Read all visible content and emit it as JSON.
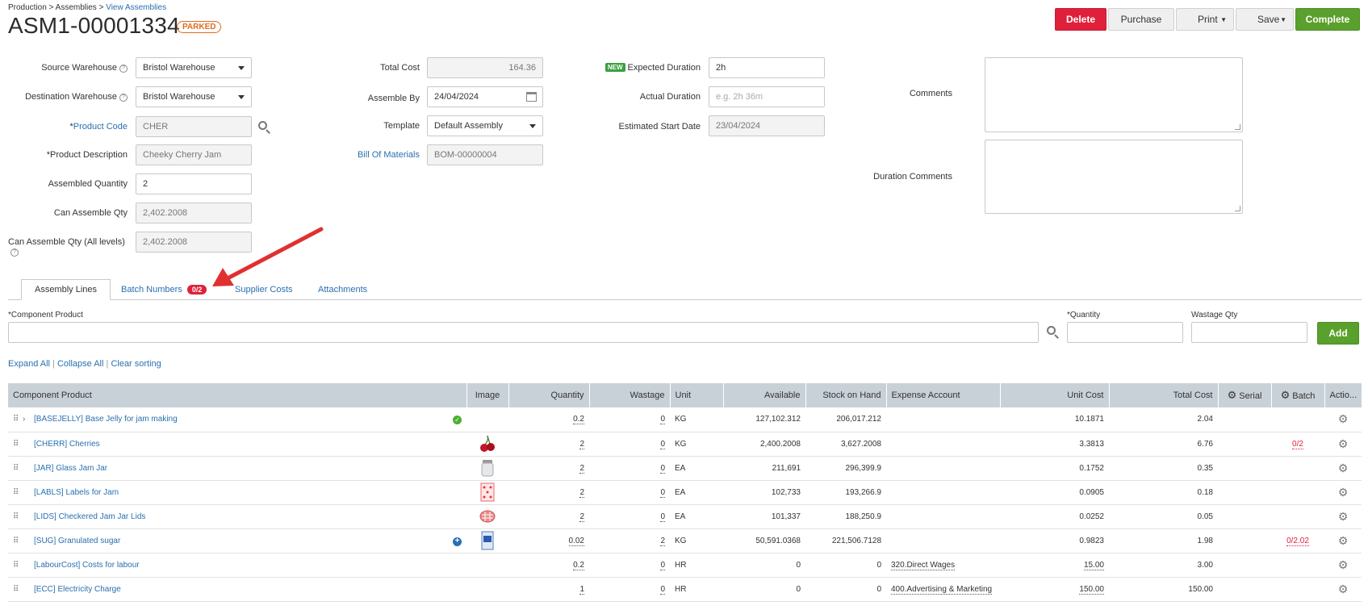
{
  "breadcrumb": {
    "part1": "Production",
    "sep1": " > ",
    "part2": "Assemblies",
    "sep2": " > ",
    "part3": "View Assemblies"
  },
  "header": {
    "title": "ASM1-00001334",
    "status": "PARKED"
  },
  "actions": {
    "delete": "Delete",
    "purchase": "Purchase",
    "print": "Print",
    "save": "Save",
    "complete": "Complete"
  },
  "form": {
    "source_warehouse_label": "Source Warehouse",
    "source_warehouse": "Bristol Warehouse",
    "destination_warehouse_label": "Destination Warehouse",
    "destination_warehouse": "Bristol Warehouse",
    "product_code_label": "Product Code",
    "product_code": "CHER",
    "product_description_label": "Product Description",
    "product_description": "Cheeky Cherry Jam",
    "assembled_quantity_label": "Assembled Quantity",
    "assembled_quantity": "2",
    "can_assemble_label": "Can Assemble Qty",
    "can_assemble": "2,402.2008",
    "can_assemble_all_label": "Can Assemble Qty (All levels)",
    "can_assemble_all": "2,402.2008",
    "total_cost_label": "Total Cost",
    "total_cost": "164.36",
    "assemble_by_label": "Assemble By",
    "assemble_by": "24/04/2024",
    "template_label": "Template",
    "template": "Default Assembly",
    "bom_label": "Bill Of Materials",
    "bom": "BOM-00000004",
    "new_badge": "NEW",
    "expected_duration_label": "Expected Duration",
    "expected_duration": "2h",
    "actual_duration_label": "Actual Duration",
    "actual_duration_placeholder": "e.g. 2h 36m",
    "estimated_start_label": "Estimated Start Date",
    "estimated_start": "23/04/2024",
    "comments_label": "Comments",
    "duration_comments_label": "Duration Comments"
  },
  "tabs": [
    {
      "label": "Assembly Lines"
    },
    {
      "label": "Batch Numbers",
      "badge": "0/2"
    },
    {
      "label": "Supplier Costs"
    },
    {
      "label": "Attachments"
    }
  ],
  "add_line": {
    "component_label": "Component Product",
    "quantity_label": "Quantity",
    "wastage_label": "Wastage Qty",
    "add": "Add"
  },
  "table_links": {
    "expand": "Expand All",
    "sep": " | ",
    "collapse": "Collapse All",
    "clear": "Clear sorting"
  },
  "table": {
    "headers": [
      "Component Product",
      "Image",
      "Quantity",
      "Wastage",
      "Unit",
      "Available",
      "Stock on Hand",
      "Expense Account",
      "Unit Cost",
      "Total Cost",
      "Serial",
      "Batch",
      "Actio..."
    ],
    "rows": [
      {
        "product": "[BASEJELLY] Base Jelly for jam making",
        "image": "",
        "quantity": "0.2",
        "wastage": "0",
        "unit": "KG",
        "available": "127,102.312",
        "soh": "206,017.212",
        "expense": "",
        "unit_cost": "10.1871",
        "total_cost": "2.04",
        "serial": "",
        "batch": ""
      },
      {
        "product": "[CHERR] Cherries",
        "image": "cherries-thumbnail",
        "quantity": "2",
        "wastage": "0",
        "unit": "KG",
        "available": "2,400.2008",
        "soh": "3,627.2008",
        "expense": "",
        "unit_cost": "3.3813",
        "total_cost": "6.76",
        "serial": "",
        "batch": "0/2"
      },
      {
        "product": "[JAR] Glass Jam Jar",
        "image": "jar-thumbnail",
        "quantity": "2",
        "wastage": "0",
        "unit": "EA",
        "available": "211,691",
        "soh": "296,399.9",
        "expense": "",
        "unit_cost": "0.1752",
        "total_cost": "0.35",
        "serial": "",
        "batch": ""
      },
      {
        "product": "[LABLS] Labels for Jam",
        "image": "labels-thumbnail",
        "quantity": "2",
        "wastage": "0",
        "unit": "EA",
        "available": "102,733",
        "soh": "193,266.9",
        "expense": "",
        "unit_cost": "0.0905",
        "total_cost": "0.18",
        "serial": "",
        "batch": ""
      },
      {
        "product": "[LIDS] Checkered Jam Jar Lids",
        "image": "lids-thumbnail",
        "quantity": "2",
        "wastage": "0",
        "unit": "EA",
        "available": "101,337",
        "soh": "188,250.9",
        "expense": "",
        "unit_cost": "0.0252",
        "total_cost": "0.05",
        "serial": "",
        "batch": ""
      },
      {
        "product": "[SUG] Granulated sugar",
        "image": "sugar-thumbnail",
        "quantity": "0.02",
        "wastage": "2",
        "unit": "KG",
        "available": "50,591.0368",
        "soh": "221,506.7128",
        "expense": "",
        "unit_cost": "0.9823",
        "total_cost": "1.98",
        "serial": "",
        "batch": "0/2.02"
      },
      {
        "product": "[LabourCost] Costs for labour",
        "image": "",
        "quantity": "0.2",
        "wastage": "0",
        "unit": "HR",
        "available": "0",
        "soh": "0",
        "expense": "320.Direct Wages",
        "unit_cost": "15.00",
        "total_cost": "3.00",
        "serial": "",
        "batch": ""
      },
      {
        "product": "[ECC] Electricity Charge",
        "image": "",
        "quantity": "1",
        "wastage": "0",
        "unit": "HR",
        "available": "0",
        "soh": "0",
        "expense": "400.Advertising & Marketing",
        "unit_cost": "150.00",
        "total_cost": "150.00",
        "serial": "",
        "batch": ""
      }
    ]
  },
  "colors": {
    "accent_red": "#e0203a",
    "accent_green": "#5aa02c",
    "link": "#2a6fb0",
    "header_bg": "#c9d1d8",
    "annotation_arrow": "#e03030"
  }
}
